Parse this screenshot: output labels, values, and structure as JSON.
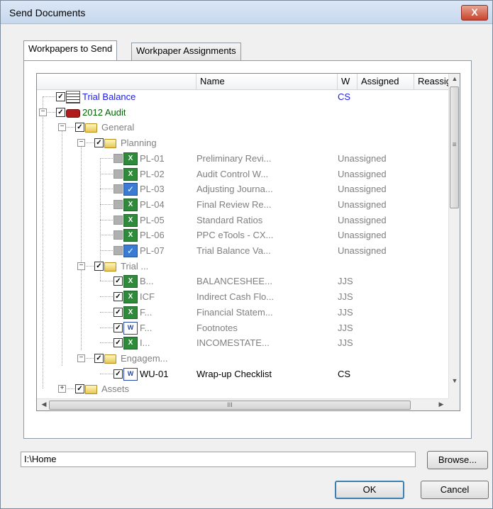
{
  "window": {
    "title": "Send Documents",
    "close_label": "X"
  },
  "tabs": [
    {
      "label": "Workpapers to Send",
      "active": true
    },
    {
      "label": "Workpaper Assignments",
      "active": false
    }
  ],
  "columns": [
    "Name",
    "W",
    "Assigned",
    "Reassigne"
  ],
  "tree": [
    {
      "depth": 0,
      "expander": "",
      "checkbox": "checked",
      "icon": "grid-icon",
      "label": "Trial Balance",
      "name": "",
      "w": "CS",
      "assigned": "",
      "color": "blue"
    },
    {
      "depth": 0,
      "expander": "-",
      "checkbox": "checked",
      "icon": "binder-icon",
      "label": "2012 Audit",
      "name": "",
      "w": "",
      "assigned": "",
      "color": "green"
    },
    {
      "depth": 1,
      "expander": "-",
      "checkbox": "checked",
      "icon": "folder-icon",
      "label": "General",
      "name": "",
      "w": "",
      "assigned": "",
      "color": "gray"
    },
    {
      "depth": 2,
      "expander": "-",
      "checkbox": "checked",
      "icon": "folder-icon",
      "label": "Planning",
      "name": "",
      "w": "",
      "assigned": "",
      "color": "gray"
    },
    {
      "depth": 3,
      "expander": "",
      "checkbox": "grey",
      "icon": "excel-icon",
      "label": "PL-01",
      "name": "Preliminary Revi...",
      "w": "",
      "assigned": "Unassigned",
      "color": "gray"
    },
    {
      "depth": 3,
      "expander": "",
      "checkbox": "grey",
      "icon": "excel-icon",
      "label": "PL-02",
      "name": "Audit Control W...",
      "w": "",
      "assigned": "Unassigned",
      "color": "gray"
    },
    {
      "depth": 3,
      "expander": "",
      "checkbox": "grey",
      "icon": "checklist-icon",
      "label": "PL-03",
      "name": "Adjusting Journa...",
      "w": "",
      "assigned": "Unassigned",
      "color": "gray"
    },
    {
      "depth": 3,
      "expander": "",
      "checkbox": "grey",
      "icon": "excel-icon",
      "label": "PL-04",
      "name": "Final Review Re...",
      "w": "",
      "assigned": "Unassigned",
      "color": "gray"
    },
    {
      "depth": 3,
      "expander": "",
      "checkbox": "grey",
      "icon": "excel-icon",
      "label": "PL-05",
      "name": "Standard Ratios",
      "w": "",
      "assigned": "Unassigned",
      "color": "gray"
    },
    {
      "depth": 3,
      "expander": "",
      "checkbox": "grey",
      "icon": "excel-icon",
      "label": "PL-06",
      "name": "PPC eTools - CX...",
      "w": "",
      "assigned": "Unassigned",
      "color": "gray"
    },
    {
      "depth": 3,
      "expander": "",
      "checkbox": "grey",
      "icon": "checklist-icon",
      "label": "PL-07",
      "name": "Trial Balance Va...",
      "w": "",
      "assigned": "Unassigned",
      "color": "gray"
    },
    {
      "depth": 2,
      "expander": "-",
      "checkbox": "checked",
      "icon": "folder-icon",
      "label": "Trial ...",
      "name": "",
      "w": "",
      "assigned": "",
      "color": "gray"
    },
    {
      "depth": 3,
      "expander": "",
      "checkbox": "checked",
      "icon": "excel-icon",
      "label": "B...",
      "name": "BALANCESHEE...",
      "w": "JJS",
      "assigned": "",
      "color": "gray"
    },
    {
      "depth": 3,
      "expander": "",
      "checkbox": "checked",
      "icon": "excel-icon",
      "label": "ICF",
      "name": "Indirect Cash Flo...",
      "w": "JJS",
      "assigned": "",
      "color": "gray"
    },
    {
      "depth": 3,
      "expander": "",
      "checkbox": "checked",
      "icon": "excel-icon",
      "label": "F...",
      "name": "Financial Statem...",
      "w": "JJS",
      "assigned": "",
      "color": "gray"
    },
    {
      "depth": 3,
      "expander": "",
      "checkbox": "checked",
      "icon": "word-icon",
      "label": "F...",
      "name": "Footnotes",
      "w": "JJS",
      "assigned": "",
      "color": "gray"
    },
    {
      "depth": 3,
      "expander": "",
      "checkbox": "checked",
      "icon": "excel-icon",
      "label": "I...",
      "name": "INCOMESTATE...",
      "w": "JJS",
      "assigned": "",
      "color": "gray"
    },
    {
      "depth": 2,
      "expander": "-",
      "checkbox": "checked",
      "icon": "folder-icon",
      "label": "Engagem...",
      "name": "",
      "w": "",
      "assigned": "",
      "color": "gray"
    },
    {
      "depth": 3,
      "expander": "",
      "checkbox": "checked",
      "icon": "word-icon",
      "label": "WU-01",
      "name": "Wrap-up Checklist",
      "w": "CS",
      "assigned": "",
      "color": "black"
    },
    {
      "depth": 1,
      "expander": "+",
      "checkbox": "checked",
      "icon": "folder-icon",
      "label": "Assets",
      "name": "",
      "w": "",
      "assigned": "",
      "color": "gray"
    }
  ],
  "scroll": {
    "hscroll_mark": "III",
    "vscroll_mark": "≡"
  },
  "path": {
    "value": "I:\\Home"
  },
  "buttons": {
    "browse": "Browse...",
    "ok": "OK",
    "cancel": "Cancel"
  }
}
